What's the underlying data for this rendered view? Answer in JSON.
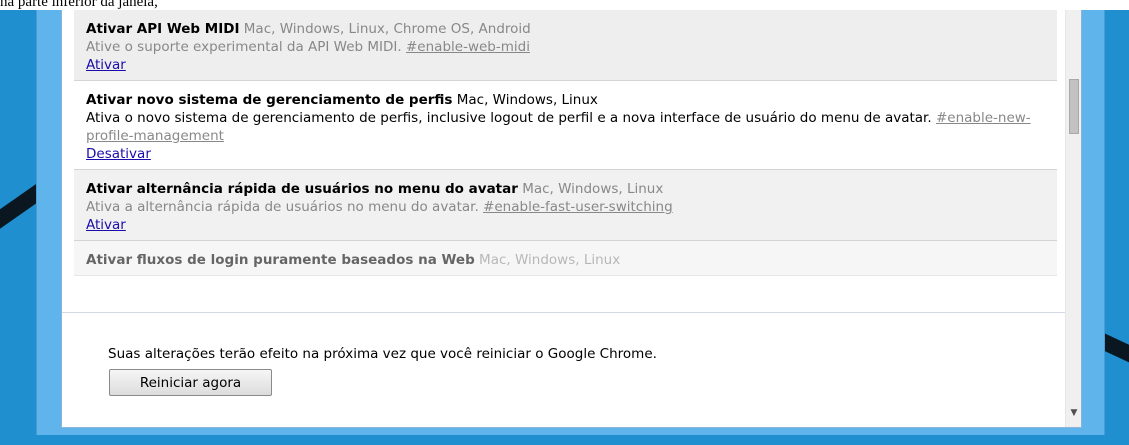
{
  "caption": "na parte inferior da janela,",
  "colors": {
    "desktop": "#1f8fd0",
    "window_frame": "#5fb4ec",
    "link": "#1a0dab",
    "disabled_text": "#888888",
    "available_row": "#f1f1f1",
    "enabled_row": "#ffffff"
  },
  "experiments": [
    {
      "state": "available",
      "name": "Ativar API Web MIDI",
      "platforms": "Mac, Windows, Linux, Chrome OS, Android",
      "description": "Ative o suporte experimental da API Web MIDI.",
      "flag": "#enable-web-midi",
      "action": "Ativar"
    },
    {
      "state": "enabled",
      "name": "Ativar novo sistema de gerenciamento de perfis",
      "platforms": "Mac, Windows, Linux",
      "description": "Ativa o novo sistema de gerenciamento de perfis, inclusive logout de perfil e a nova interface de usuário do menu de avatar.",
      "flag": "#enable-new-profile-management",
      "action": "Desativar"
    },
    {
      "state": "available",
      "name": "Ativar alternância rápida de usuários no menu do avatar",
      "platforms": "Mac, Windows, Linux",
      "description": "Ativa a alternância rápida de usuários no menu do avatar.",
      "flag": "#enable-fast-user-switching",
      "action": "Ativar"
    },
    {
      "state": "available",
      "name": "Ativar fluxos de login puramente baseados na Web",
      "platforms": "Mac, Windows, Linux"
    }
  ],
  "footer": {
    "notice": "Suas alterações terão efeito na próxima vez que você reiniciar o Google Chrome.",
    "restart_label": "Reiniciar agora"
  },
  "scrollbar": {
    "down_arrow_icon": "triangle-down-icon"
  }
}
